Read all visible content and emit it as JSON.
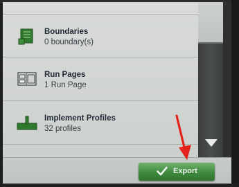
{
  "list": {
    "items": [
      {
        "title": "Boundaries",
        "subtitle": "0 boundary(s)",
        "icon": "boundary-icon"
      },
      {
        "title": "Run Pages",
        "subtitle": "1 Run Page",
        "icon": "run-page-icon"
      },
      {
        "title": "Implement Profiles",
        "subtitle": "32 profiles",
        "icon": "implement-icon"
      }
    ]
  },
  "scrollbar": {
    "down_icon": "triangle-down-icon"
  },
  "footer": {
    "export_label": "Export",
    "export_icon": "checkmark-icon"
  },
  "colors": {
    "accent_green": "#3f8a3e",
    "annotation_red": "#e4241c"
  }
}
